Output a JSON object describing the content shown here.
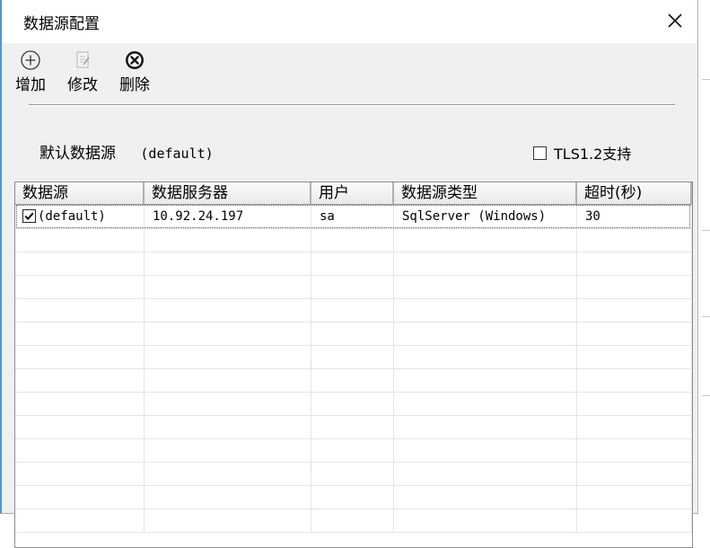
{
  "window": {
    "title": "数据源配置"
  },
  "toolbar": {
    "add_label": "增加",
    "edit_label": "修改",
    "delete_label": "删除"
  },
  "default_source": {
    "label": "默认数据源",
    "value": "(default)"
  },
  "tls": {
    "label": "TLS1.2支持",
    "checked": false
  },
  "table": {
    "columns": [
      "数据源",
      "数据服务器",
      "用户",
      "数据源类型",
      "超时(秒)"
    ],
    "rows": [
      {
        "checked": true,
        "source": "(default)",
        "server": "10.92.24.197",
        "user": "sa",
        "type": "SqlServer (Windows)",
        "timeout": "30"
      }
    ]
  },
  "colors": {
    "window_border": "#4c93d6",
    "surface": "#f0f0f0"
  }
}
